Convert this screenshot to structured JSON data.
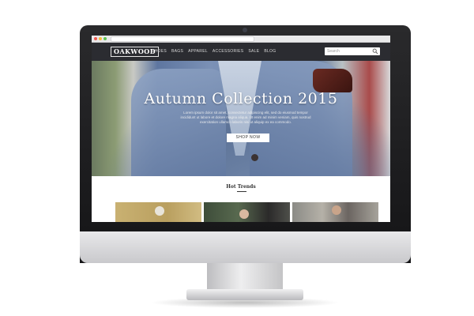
{
  "site": {
    "logo": "OAKWOOD",
    "nav": [
      "SHOES",
      "BAGS",
      "APPAREL",
      "ACCESSORIES",
      "SALE",
      "BLOG"
    ],
    "search_placeholder": "Search"
  },
  "hero": {
    "title": "Autumn Collection 2015",
    "body": "Lorem ipsum dolor sit amet, consectetur adipiscing elit, sed do eiusmod tempor incididunt ut labore et dolore magna aliqua. Ut enim ad minim veniam, quis nostrud exercitation ullamco laboris nisi ut aliquip ex ea commodo.",
    "cta": "SHOP NOW"
  },
  "trends": {
    "title": "Hot Trends"
  },
  "colors": {
    "nav_bg": "#2b2c31",
    "device_frame": "#1a1a1c",
    "accent_white": "#ffffff"
  },
  "icons": {
    "search": "search-icon",
    "camera": "camera-icon"
  }
}
